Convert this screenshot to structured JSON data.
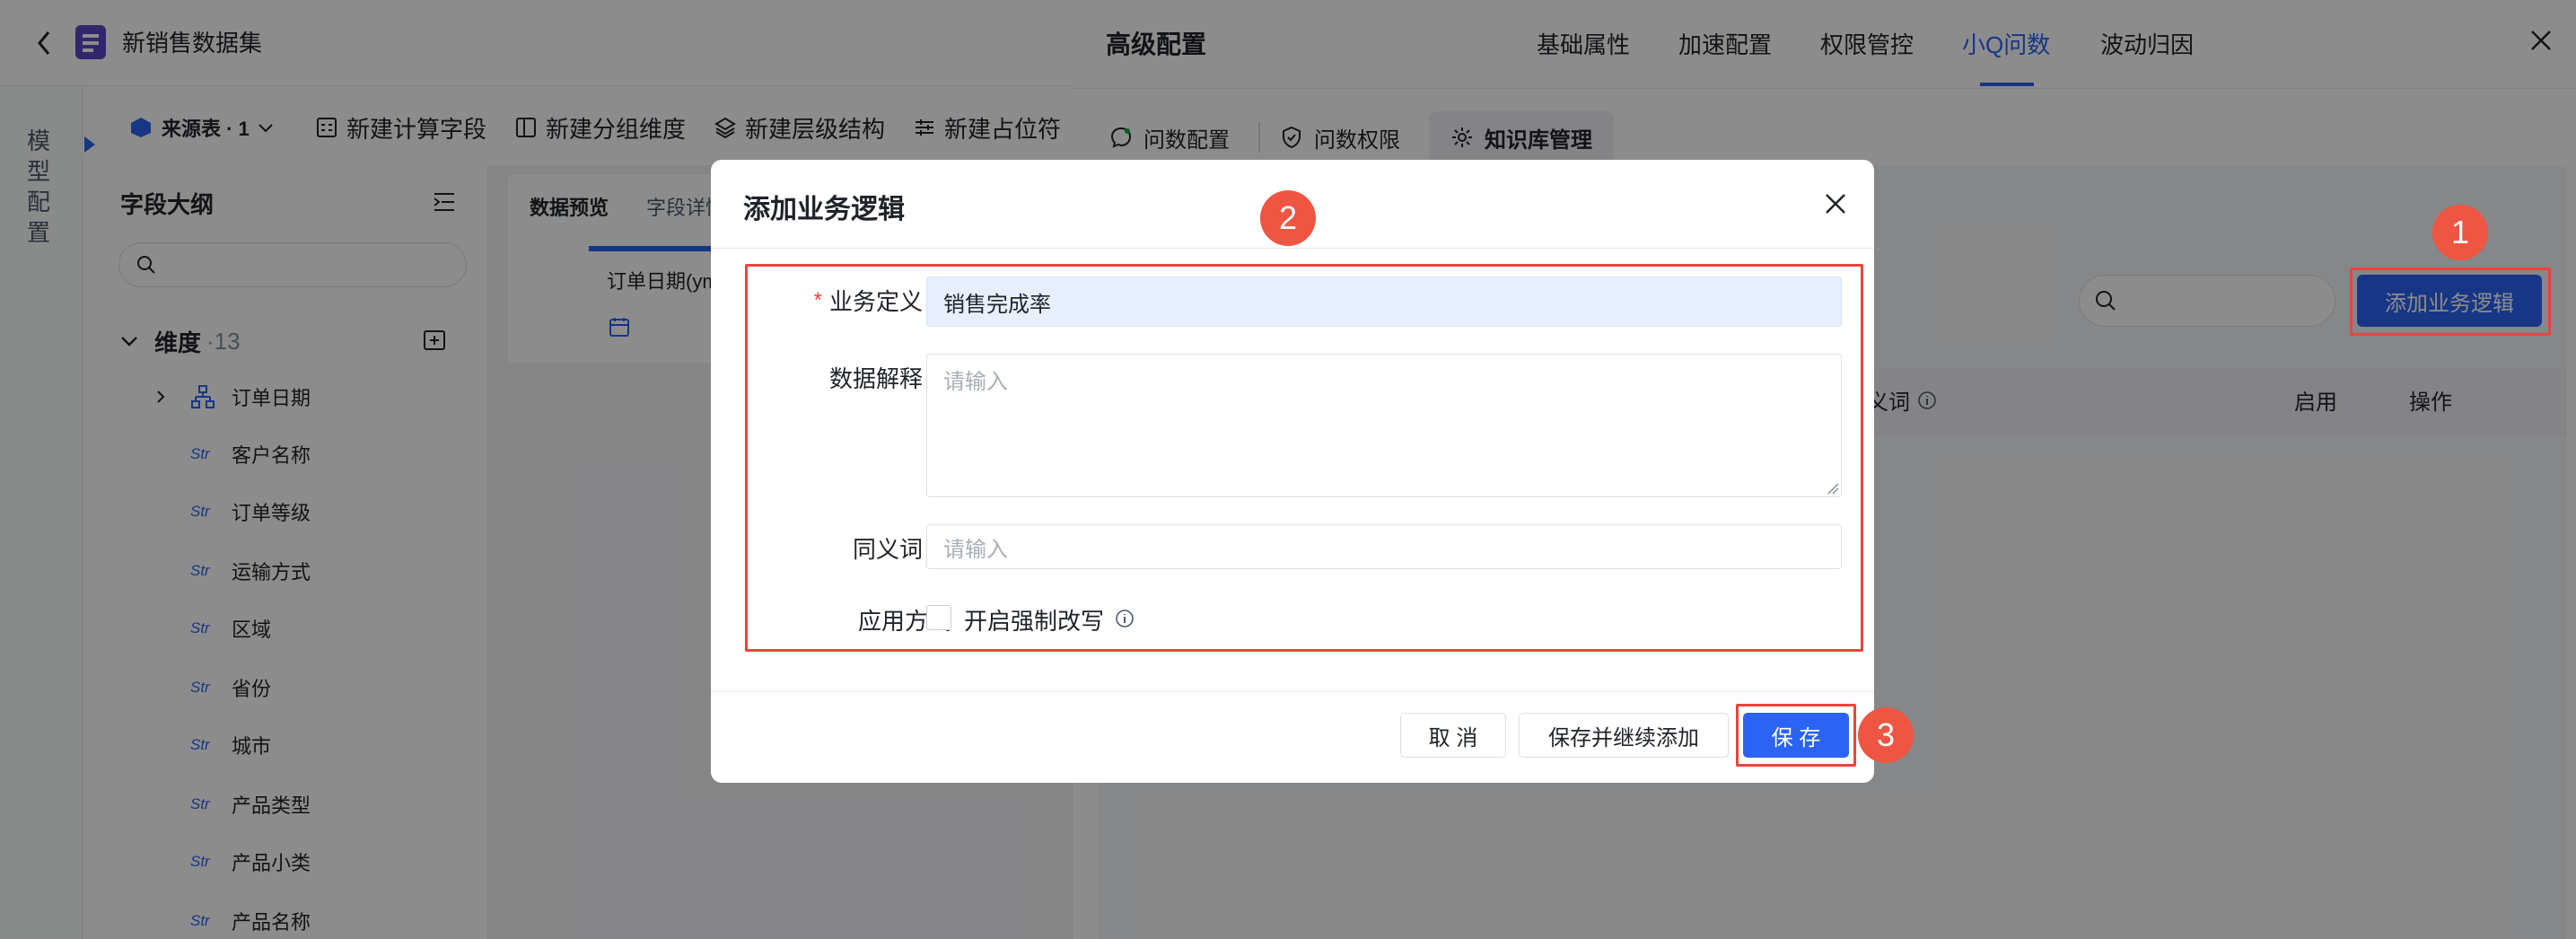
{
  "app": {
    "title": "新销售数据集"
  },
  "model_tab": {
    "label": "模型配置"
  },
  "toolbar": {
    "source": "来源表 · 1",
    "calc_field": "新建计算字段",
    "group_dim": "新建分组维度",
    "hierarchy": "新建层级结构",
    "placeholder": "新建占位符"
  },
  "field_panel": {
    "title": "字段大纲",
    "dim_label": "维度",
    "dim_count": "·13",
    "fields": [
      {
        "tag": "",
        "name": "订单日期"
      },
      {
        "tag": "Str",
        "name": "客户名称"
      },
      {
        "tag": "Str",
        "name": "订单等级"
      },
      {
        "tag": "Str",
        "name": "运输方式"
      },
      {
        "tag": "Str",
        "name": "区域"
      },
      {
        "tag": "Str",
        "name": "省份"
      },
      {
        "tag": "Str",
        "name": "城市"
      },
      {
        "tag": "Str",
        "name": "产品类型"
      },
      {
        "tag": "Str",
        "name": "产品小类"
      },
      {
        "tag": "Str",
        "name": "产品名称"
      }
    ]
  },
  "preview": {
    "tab_data": "数据预览",
    "tab_detail": "字段详情",
    "col_header": "订单日期(ym"
  },
  "drawer": {
    "title": "高级配置",
    "tabs": [
      "基础属性",
      "加速配置",
      "权限管控",
      "小Q问数",
      "波动归因"
    ],
    "active_tab": "小Q问数",
    "sub_tabs": [
      "问数配置",
      "问数权限",
      "知识库管理"
    ],
    "add_button": "添加业务逻辑",
    "col_synonym": "义词",
    "col_enable": "启用",
    "col_action": "操作"
  },
  "modal": {
    "title": "添加业务逻辑",
    "biz_def_label": "业务定义",
    "biz_def_value": "销售完成率",
    "data_explain_label": "数据解释",
    "data_explain_placeholder": "请输入",
    "synonym_label": "同义词",
    "synonym_placeholder": "请输入",
    "apply_label": "应用方式",
    "force_rewrite_label": "开启强制改写",
    "cancel": "取 消",
    "save_continue": "保存并继续添加",
    "save": "保 存"
  },
  "annotations": {
    "b1": "1",
    "b2": "2",
    "b3": "3"
  },
  "colors": {
    "accent": "#2b63f5",
    "annotation": "#e8453c"
  }
}
